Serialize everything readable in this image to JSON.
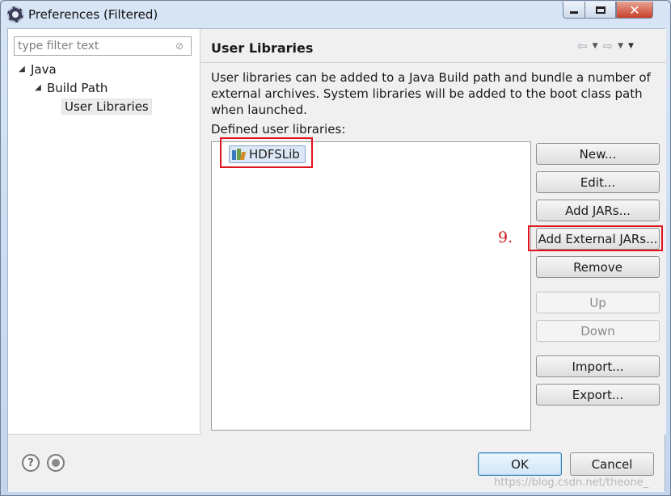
{
  "window": {
    "title": "Preferences (Filtered)",
    "close_glyph": "✕",
    "icons": [
      "eclipse-preferences-icon",
      "minimize-icon",
      "maximize-icon",
      "close-icon"
    ]
  },
  "left_pane": {
    "filter": {
      "value": "",
      "placeholder": "type filter text",
      "clear_icon": "clear-filter-icon"
    },
    "tree": [
      {
        "label": "Java",
        "expanded": true,
        "level": 0
      },
      {
        "label": "Build Path",
        "expanded": true,
        "level": 1
      },
      {
        "label": "User Libraries",
        "selected": true,
        "level": 2
      }
    ]
  },
  "page": {
    "title": "User Libraries",
    "nav_icons": [
      "back-arrow-icon",
      "forward-arrow-icon",
      "view-menu-icon"
    ],
    "description": "User libraries can be added to a Java Build path and bundle a number of external archives. System libraries will be added to the boot class path when launched.",
    "list_label": "Defined user libraries:",
    "libraries": [
      {
        "name": "HDFSLib",
        "icon": "library-icon"
      }
    ],
    "buttons": [
      {
        "label": "New...",
        "enabled": true
      },
      {
        "label": "Edit...",
        "enabled": true
      },
      {
        "label": "Add JARs...",
        "enabled": true
      },
      {
        "label": "Add External JARs...",
        "enabled": true,
        "highlighted": true
      },
      {
        "label": "Remove",
        "enabled": true
      },
      {
        "label": "Up",
        "enabled": false
      },
      {
        "label": "Down",
        "enabled": false
      },
      {
        "label": "Import...",
        "enabled": true
      },
      {
        "label": "Export...",
        "enabled": true
      }
    ],
    "annotation": {
      "step_label": "9.",
      "color": "#e0141f"
    }
  },
  "footer": {
    "help_icon": "help-icon",
    "help_glyph": "?",
    "record_icon": "oomph-preference-recorder-icon",
    "ok_label": "OK",
    "cancel_label": "Cancel",
    "watermark": "https://blog.csdn.net/theone_"
  }
}
